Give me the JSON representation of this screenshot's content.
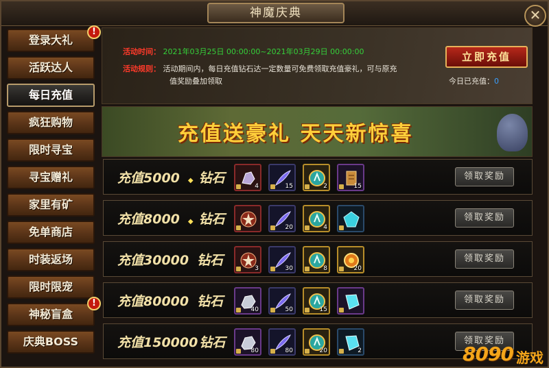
{
  "window": {
    "title": "神魔庆典",
    "close_symbol": "✕"
  },
  "sidebar": {
    "items": [
      {
        "label": "登录大礼",
        "alert": "!"
      },
      {
        "label": "活跃达人"
      },
      {
        "label": "每日充值",
        "active": true
      },
      {
        "label": "疯狂购物"
      },
      {
        "label": "限时寻宝"
      },
      {
        "label": "寻宝赠礼"
      },
      {
        "label": "家里有矿"
      },
      {
        "label": "免单商店"
      },
      {
        "label": "时装返场"
      },
      {
        "label": "限时限宠"
      },
      {
        "label": "神秘盲盒",
        "alert": "!"
      },
      {
        "label": "庆典BOSS"
      }
    ]
  },
  "info": {
    "time_label": "活动时间：",
    "time_value": "2021年03月25日  00:00:00~2021年03月29日  00:00:00",
    "rule_label": "活动规则：",
    "rule_line1": "活动期间内，每日充值钻石达一定数量可免费领取充值豪礼，可与原充",
    "rule_line2": "值奖励叠加领取",
    "recharge_button": "立即充值",
    "today_label": "今日已充值：",
    "today_value": "0"
  },
  "banner": {
    "text": "充值送豪礼   天天新惊喜"
  },
  "colors": {
    "accent_red": "#ff3a2a",
    "green_text": "#35d03a",
    "gold_text": "#ffcf3a"
  },
  "tiers": [
    {
      "prefix": "充值",
      "amount": "5000",
      "unit": "钻石",
      "claim": "领取奖励",
      "items": [
        {
          "icon": "crystal-ore-icon",
          "count": "4"
        },
        {
          "icon": "feather-icon",
          "count": "15"
        },
        {
          "icon": "medal-icon",
          "count": "2"
        },
        {
          "icon": "scroll-icon",
          "count": "15"
        }
      ]
    },
    {
      "prefix": "充值",
      "amount": "8000",
      "unit": "钻石",
      "claim": "领取奖励",
      "items": [
        {
          "icon": "star-gem-icon",
          "count": ""
        },
        {
          "icon": "feather-icon",
          "count": "20"
        },
        {
          "icon": "medal-icon",
          "count": "4"
        },
        {
          "icon": "blue-gem-icon",
          "count": ""
        }
      ]
    },
    {
      "prefix": "充值",
      "amount": "30000",
      "unit": "钻石",
      "claim": "领取奖励",
      "items": [
        {
          "icon": "star-gem-icon",
          "count": "3"
        },
        {
          "icon": "feather-icon",
          "count": "30"
        },
        {
          "icon": "medal-icon",
          "count": "8"
        },
        {
          "icon": "fire-orb-icon",
          "count": "20"
        }
      ]
    },
    {
      "prefix": "充值",
      "amount": "80000",
      "unit": "钻石",
      "claim": "领取奖励",
      "items": [
        {
          "icon": "silver-ore-icon",
          "count": "40"
        },
        {
          "icon": "feather-icon",
          "count": "50"
        },
        {
          "icon": "medal-icon",
          "count": "15"
        },
        {
          "icon": "diamond-icon",
          "count": ""
        }
      ]
    },
    {
      "prefix": "充值",
      "amount": "150000",
      "unit": "钻石",
      "claim": "领取奖励",
      "items": [
        {
          "icon": "silver-ore-icon",
          "count": "80"
        },
        {
          "icon": "feather-icon",
          "count": "80"
        },
        {
          "icon": "medal-icon",
          "count": "20"
        },
        {
          "icon": "diamond-icon",
          "count": "2"
        }
      ]
    }
  ],
  "watermark": {
    "text": "8090",
    "sub": "游戏"
  }
}
